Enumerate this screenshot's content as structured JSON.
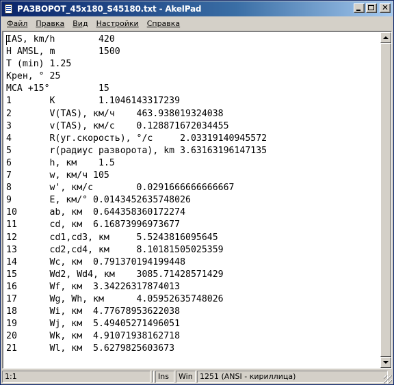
{
  "window": {
    "title": "РАЗВОРОТ_45x180_S45180.txt - AkelPad",
    "icon": "notepad-document-icon",
    "controls": [
      "minimize-icon",
      "maximize-icon",
      "close-icon"
    ],
    "close_glyph": "✕"
  },
  "menu": [
    {
      "label": "Файл"
    },
    {
      "label": "Правка"
    },
    {
      "label": "Вид"
    },
    {
      "label": "Настройки"
    },
    {
      "label": "Справка"
    }
  ],
  "editor": {
    "lines": [
      "IAS, km/h        420",
      "H AMSL, m        1500",
      "T (min) 1.25",
      "Крен, ° 25",
      "MCA +15°         15",
      "1       K        1.1046143317239",
      "2       V(TAS), км/ч    463.938019324038",
      "3       v(TAS), км/с    0.128871672034455",
      "4       R(уг.скорость), °/c     2.03319140945572",
      "5       r(радиус разворота), km 3.63163196147135",
      "6       h, км    1.5",
      "7       w, км/ч 105",
      "8       w', км/с        0.0291666666666667",
      "9       E, км/° 0.0143452635748026",
      "10      ab, км  0.644358360172274",
      "11      cd, км  6.16873996973677",
      "12      cd1,cd3, км     5.5243816095645",
      "13      cd2,cd4, км     8.10181505025359",
      "14      Wc, км  0.791370194199448",
      "15      Wd2, Wd4, км    3085.71428571429",
      "16      Wf, км  3.34226317874013",
      "17      Wg, Wh, км      4.05952635748026",
      "18      Wi, км  4.77678953622038",
      "19      Wj, км  5.49405271496051",
      "20      Wk, км  4.91071938162718",
      "21      Wl, км  5.6279825603673"
    ]
  },
  "statusbar": {
    "position": "1:1",
    "modified": "",
    "insert_mode": "Ins",
    "newline": "Win",
    "encoding": "1251  (ANSI - кириллица)"
  },
  "colors": {
    "title_gradient_start": "#0a246a",
    "title_gradient_end": "#a6caf0",
    "chrome": "#d4d0c8"
  }
}
